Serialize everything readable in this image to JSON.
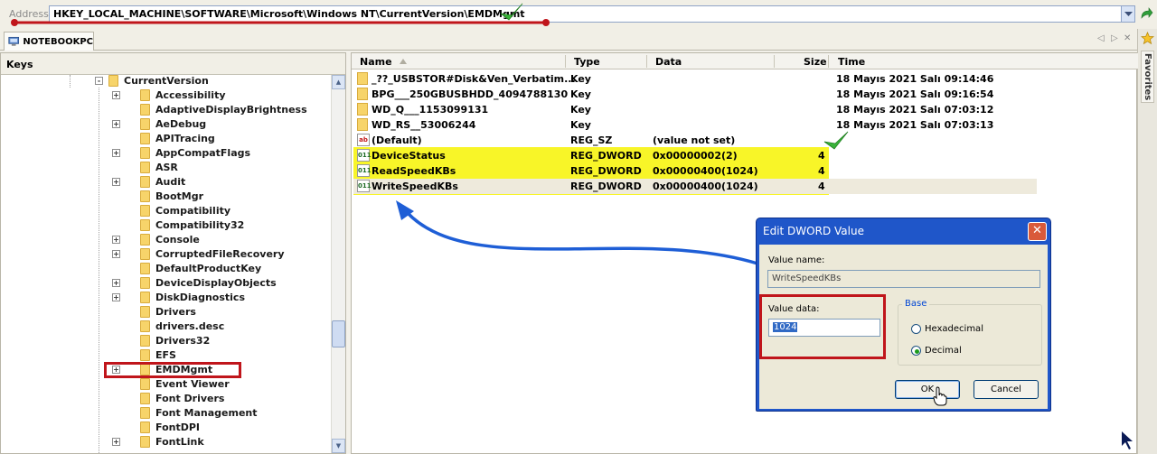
{
  "address": {
    "label": "Address",
    "path": "HKEY_LOCAL_MACHINE\\SOFTWARE\\Microsoft\\Windows NT\\CurrentVersion\\EMDMgmt"
  },
  "tab": {
    "label": "NOTEBOOKPC"
  },
  "favorites": {
    "label": "Favorites"
  },
  "keys": {
    "header": "Keys",
    "items": [
      {
        "label": "CurrentVersion",
        "expander": "-"
      },
      {
        "label": "Accessibility",
        "expander": "+"
      },
      {
        "label": "AdaptiveDisplayBrightness",
        "expander": ""
      },
      {
        "label": "AeDebug",
        "expander": "+"
      },
      {
        "label": "APITracing",
        "expander": ""
      },
      {
        "label": "AppCompatFlags",
        "expander": "+"
      },
      {
        "label": "ASR",
        "expander": ""
      },
      {
        "label": "Audit",
        "expander": "+"
      },
      {
        "label": "BootMgr",
        "expander": ""
      },
      {
        "label": "Compatibility",
        "expander": ""
      },
      {
        "label": "Compatibility32",
        "expander": ""
      },
      {
        "label": "Console",
        "expander": "+"
      },
      {
        "label": "CorruptedFileRecovery",
        "expander": "+"
      },
      {
        "label": "DefaultProductKey",
        "expander": ""
      },
      {
        "label": "DeviceDisplayObjects",
        "expander": "+"
      },
      {
        "label": "DiskDiagnostics",
        "expander": "+"
      },
      {
        "label": "Drivers",
        "expander": ""
      },
      {
        "label": "drivers.desc",
        "expander": ""
      },
      {
        "label": "Drivers32",
        "expander": ""
      },
      {
        "label": "EFS",
        "expander": ""
      },
      {
        "label": "EMDMgmt",
        "expander": "+"
      },
      {
        "label": "Event Viewer",
        "expander": ""
      },
      {
        "label": "Font Drivers",
        "expander": ""
      },
      {
        "label": "Font Management",
        "expander": ""
      },
      {
        "label": "FontDPI",
        "expander": ""
      },
      {
        "label": "FontLink",
        "expander": "+"
      }
    ]
  },
  "values": {
    "columns": {
      "name": "Name",
      "type": "Type",
      "data": "Data",
      "size": "Size",
      "time": "Time"
    },
    "rows": [
      {
        "name": "_??_USBSTOR#Disk&Ven_Verbatim...",
        "type": "Key",
        "data": "",
        "size": "",
        "time": "18 Mayıs 2021 Salı 09:14:46",
        "icon": "folder"
      },
      {
        "name": "BPG___250GBUSBHDD_4094788130",
        "type": "Key",
        "data": "",
        "size": "",
        "time": "18 Mayıs 2021 Salı 09:16:54",
        "icon": "folder"
      },
      {
        "name": "WD_Q___1153099131",
        "type": "Key",
        "data": "",
        "size": "",
        "time": "18 Mayıs 2021 Salı 07:03:12",
        "icon": "folder"
      },
      {
        "name": "WD_RS__53006244",
        "type": "Key",
        "data": "",
        "size": "",
        "time": "18 Mayıs 2021 Salı 07:03:13",
        "icon": "folder"
      },
      {
        "name": "(Default)",
        "type": "REG_SZ",
        "data": "(value not set)",
        "size": "",
        "time": "",
        "icon": "string"
      },
      {
        "name": "DeviceStatus",
        "type": "REG_DWORD",
        "data": "0x00000002(2)",
        "size": "4",
        "time": "",
        "icon": "dword"
      },
      {
        "name": "ReadSpeedKBs",
        "type": "REG_DWORD",
        "data": "0x00000400(1024)",
        "size": "4",
        "time": "",
        "icon": "dword"
      },
      {
        "name": "WriteSpeedKBs",
        "type": "REG_DWORD",
        "data": "0x00000400(1024)",
        "size": "4",
        "time": "",
        "icon": "dword"
      }
    ],
    "icon_text": {
      "string": "ab",
      "dword": "011"
    }
  },
  "dialog": {
    "title": "Edit DWORD Value",
    "close_glyph": "✕",
    "value_name_label": "Value name:",
    "value_name": "WriteSpeedKBs",
    "value_data_label": "Value data:",
    "value_data": "1024",
    "base_label": "Base",
    "hex_label": "Hexadecimal",
    "dec_label": "Decimal",
    "selected_base": "Decimal",
    "ok_label": "OK",
    "cancel_label": "Cancel"
  },
  "colors": {
    "highlight_yellow": "#f8f528",
    "annotation_red": "#c0151b",
    "annotation_blue": "#1e5ed6",
    "check_green": "#39b33a",
    "dialog_titlebar": "#1f56c9"
  }
}
